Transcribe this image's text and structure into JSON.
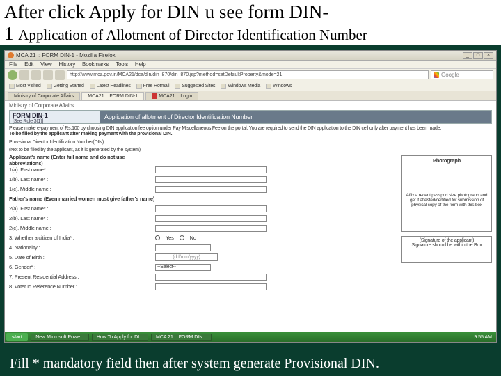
{
  "slide": {
    "title_line1": "After click Apply for DIN u see form DIN-",
    "title_line2_prefix": "1 ",
    "title_line2_rest": "Application of Allotment of Director Identification Number",
    "footer": "Fill * mandatory field then after system generate Provisional DIN."
  },
  "browser": {
    "title": "MCA 21 :: FORM DIN-1 - Mozilla Firefox",
    "menu": [
      "File",
      "Edit",
      "View",
      "History",
      "Bookmarks",
      "Tools",
      "Help"
    ],
    "url": "http://www.mca.gov.in/MCA21/dca/din/din_870/din_870.jsp?method=setDefaultProperty&mode=21",
    "search_placeholder": "Google",
    "bookmarks": [
      "Most Visited",
      "Getting Started",
      "Latest Headlines",
      "Free Hotmail",
      "Suggested Sites",
      "Windows Media",
      "Windows"
    ],
    "tabs": [
      {
        "label": "Ministry of Corporate Affairs",
        "active": false
      },
      {
        "label": "MCA21 :: FORM DIN-1",
        "active": true
      },
      {
        "label": "MCA21 :: Login",
        "active": false
      }
    ]
  },
  "form": {
    "page_path": "Ministry of Corporate Affairs",
    "header_left_title": "FORM DIN-1",
    "header_left_sub": "[See Rule 3(1)]",
    "header_right": "Application of allotment of Director Identification Number",
    "instructions_line1": "Please make e-payment of Rs.100 by choosing DIN application fee option under Pay Miscellaneous Fee on the portal. You are required to send the DIN application to the DIN cell only after payment has been made.",
    "instructions_line2": "To be filled by the applicant after making payment with the provisional DIN.",
    "prov_label": "Provisional Director Identification Number(DIN) :",
    "prov_hint": "(Not to be filled by the applicant, as it is generated by the system)",
    "applicant_name_hdr": "Applicant's name (Enter full name and do not use abbreviations)",
    "fields": {
      "f1a": "1(a). First name* :",
      "f1b": "1(b). Last name* :",
      "f1c": "1(c). Middle name :"
    },
    "father_hdr": "Father's name (Even married women must give father's name)",
    "father_fields": {
      "f2a": "2(a). First name* :",
      "f2b": "2(b). Last name* :",
      "f2c": "2(c). Middle name :"
    },
    "citizen_label": "3. Whether a citizen of India* :",
    "citizen_yes": "Yes",
    "citizen_no": "No",
    "nationality_label": "4. Nationality :",
    "dob_label": "5. Date of Birth :",
    "dob_hint": "(dd/mm/yyyy)",
    "gender_label": "6. Gender* :",
    "addr1": "7. Present Residential Address :",
    "addr2": "8. Voter Id Reference Number :",
    "photo": {
      "title": "Photograph",
      "note": "Affix a recent passport size photograph and get it attested/certified for submission of physical copy of the form with this box"
    },
    "sig": {
      "line1": "(Signature of the applicant)",
      "line2": "Signature should be within the Box"
    }
  },
  "taskbar": {
    "start": "start",
    "items": [
      "New Microsoft Powe...",
      "How To Apply for DI...",
      "MCA 21 :: FORM DIN..."
    ],
    "time": "9:55 AM"
  }
}
